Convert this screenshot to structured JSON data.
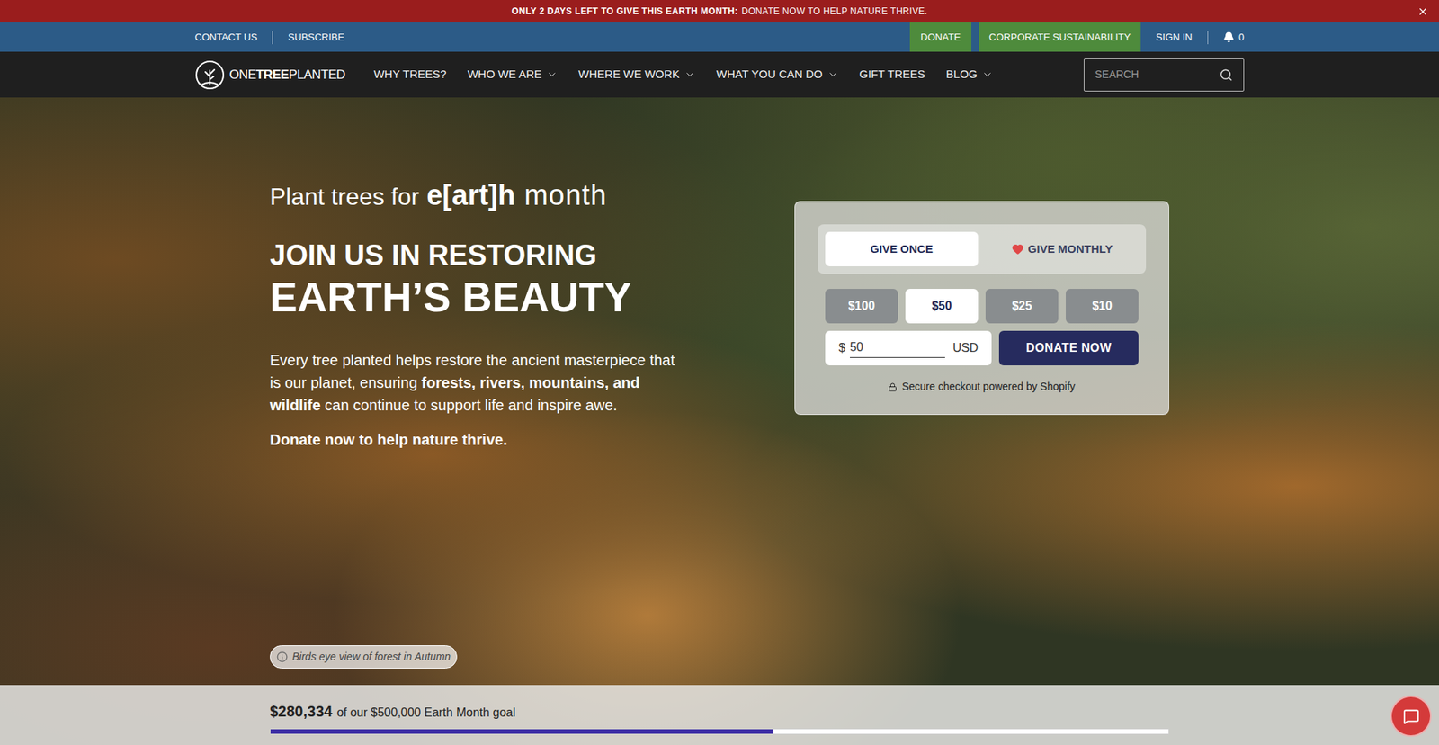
{
  "announcement": {
    "lead": "ONLY 2 DAYS LEFT TO GIVE THIS EARTH MONTH:",
    "text": "DONATE NOW TO HELP NATURE THRIVE."
  },
  "utility_bar": {
    "links": [
      "CONTACT US",
      "SUBSCRIBE"
    ],
    "buttons": [
      "DONATE",
      "CORPORATE SUSTAINABILITY"
    ],
    "sign_in": "SIGN IN",
    "notifications": "0"
  },
  "logo": {
    "first": "ONE",
    "middle": "TREE",
    "last": "PLANTED"
  },
  "nav": [
    {
      "label": "WHY TREES?",
      "dropdown": false
    },
    {
      "label": "WHO WE ARE",
      "dropdown": true
    },
    {
      "label": "WHERE WE WORK",
      "dropdown": true
    },
    {
      "label": "WHAT YOU CAN DO",
      "dropdown": true
    },
    {
      "label": "GIFT TREES",
      "dropdown": false
    },
    {
      "label": "BLOG",
      "dropdown": true
    }
  ],
  "search": {
    "placeholder": "SEARCH"
  },
  "hero": {
    "kicker": {
      "pre": "Plant trees for",
      "mark": "e[art]h",
      "post": "month"
    },
    "title_top": "JOIN US IN RESTORING",
    "title_main": "EARTH’S BEAUTY",
    "paragraph": [
      {
        "text": "Every tree planted helps restore the ancient masterpiece that is our planet, ensuring ",
        "bold": false
      },
      {
        "text": "forests, rivers, mountains, and wildlife",
        "bold": true
      },
      {
        "text": " can continue to support life and inspire awe.",
        "bold": false
      }
    ],
    "cta": "Donate now to help nature thrive."
  },
  "donation": {
    "tabs": [
      {
        "label": "GIVE ONCE",
        "selected": true,
        "kind": "plain"
      },
      {
        "label": "GIVE MONTHLY",
        "selected": false,
        "kind": "heart"
      }
    ],
    "amounts": [
      {
        "label": "$100",
        "selected": false
      },
      {
        "label": "$50",
        "selected": true
      },
      {
        "label": "$25",
        "selected": false
      },
      {
        "label": "$10",
        "selected": false
      }
    ],
    "currency_symbol": "$",
    "value": "50",
    "currency": "USD",
    "button": "DONATE NOW",
    "secure": "Secure checkout powered by Shopify"
  },
  "photo_caption": "Birds eye view of forest in Autumn",
  "goal": {
    "raised": "$280,334",
    "text": "of our $500,000 Earth Month goal",
    "level": 0.56
  }
}
